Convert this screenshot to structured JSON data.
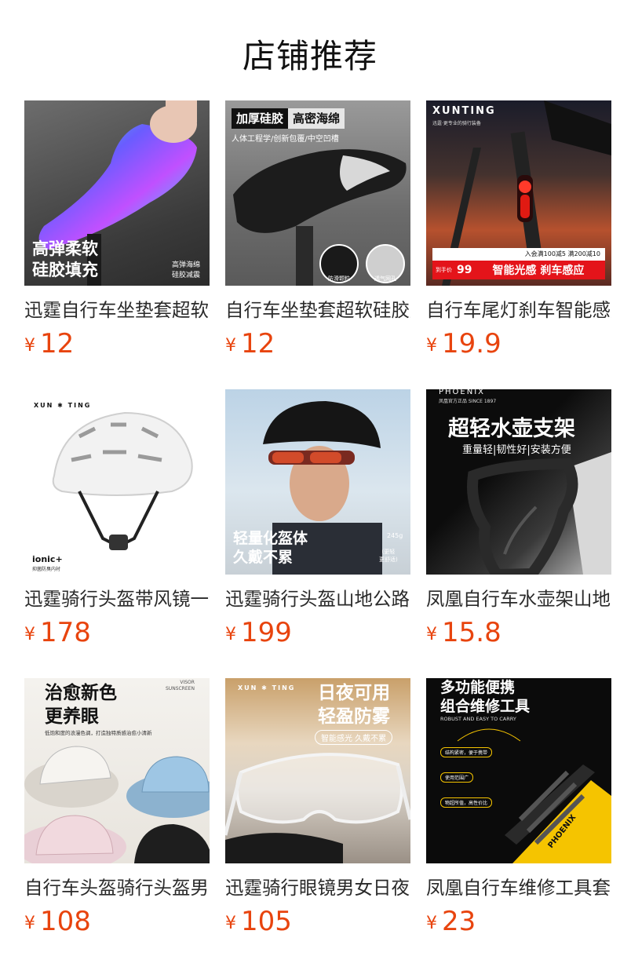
{
  "page": {
    "title": "店铺推荐"
  },
  "currency_symbol": "¥",
  "products": [
    {
      "name": "迅霆自行车坐垫套超软硅胶",
      "price": "12",
      "image": {
        "lines": [
          "高弹柔软",
          "硅胶填充"
        ],
        "small_lines": [
          "高弹海绵",
          "硅胶减震"
        ]
      }
    },
    {
      "name": "自行车坐垫套超软硅胶加厚",
      "price": "12",
      "image": {
        "tag_dark": "加厚硅胶",
        "tag_light": "高密海绵",
        "subline": "人体工程学/创新包覆/中空凹槽",
        "circle_labels": [
          "防滑颗粒",
          "透气网孔"
        ]
      }
    },
    {
      "name": "自行车尾灯刹车智能感应",
      "price": "19.9",
      "image": {
        "brand": "XUNTING",
        "brand_sub": "迅霆·更专业的骑行装备",
        "promo": "入会满100减5 满200减10",
        "badge_label": "到手价",
        "badge_price": "99",
        "banner": "智能光感 刹车感应"
      }
    },
    {
      "name": "迅霆骑行头盔带风镜一体",
      "price": "178",
      "image": {
        "brand": "XUN ✱ TING",
        "tech": "ionic+",
        "tech_sub": "抑菌防臭内衬"
      }
    },
    {
      "name": "迅霆骑行头盔山地公路车",
      "price": "199",
      "image": {
        "lines": [
          "轻量化盔体",
          "久戴不累"
        ],
        "weight": "245g",
        "note": [
          "(更轻",
          "更舒适)"
        ]
      }
    },
    {
      "name": "凤凰自行车水壶架山地车",
      "price": "15.8",
      "image": {
        "brand": "PHOENIX",
        "brand_sub": "凤凰官方正品 SINCE 1897",
        "headline": "超轻水壶支架",
        "subline": "重量轻|韧性好|安装方便"
      }
    },
    {
      "name": "自行车头盔骑行头盔男女",
      "price": "108",
      "image": {
        "lines": [
          "治愈新色",
          "更养眼"
        ],
        "corner": [
          "VISOR",
          "SUNSCREEN"
        ],
        "subline": "低饱和度的浪漫色调，打造独特质感治愈小清新"
      }
    },
    {
      "name": "迅霆骑行眼镜男女日夜两用",
      "price": "105",
      "image": {
        "brand": "XUN ✱ TING",
        "lines": [
          "日夜可用",
          "轻盈防雾"
        ],
        "pill": "智能感光 久戴不累"
      }
    },
    {
      "name": "凤凰自行车维修工具套装",
      "price": "23",
      "image": {
        "lines": [
          "多功能便携",
          "组合维修工具"
        ],
        "subline": "ROBUST AND EASY TO CARRY",
        "tags": [
          "结构紧密，便于携带",
          "使用范围广",
          "物超所值，高性价比"
        ],
        "tool_brand": "PHOENIX"
      }
    }
  ],
  "colors": {
    "price": "#e8440e",
    "title": "#111111",
    "name": "#2a2a2a"
  }
}
